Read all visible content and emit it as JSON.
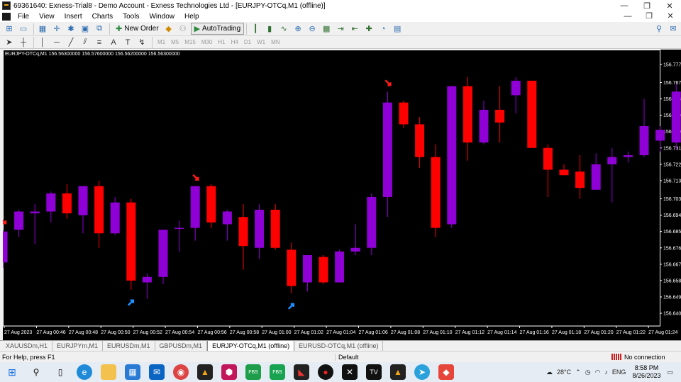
{
  "window": {
    "title": "69361640: Exness-Trial8 - Demo Account - Exness Technologies Ltd - [EURJPY-OTCq,M1 (offline)]",
    "minimize": "—",
    "restore": "❐",
    "close": "✕"
  },
  "menu": {
    "items": [
      "File",
      "View",
      "Insert",
      "Charts",
      "Tools",
      "Window",
      "Help"
    ],
    "right": [
      "—",
      "❐",
      "✕"
    ]
  },
  "toolbar": {
    "new_order": "New Order",
    "autotrading": "AutoTrading"
  },
  "timeframes": [
    "M1",
    "M5",
    "M15",
    "M30",
    "H1",
    "H4",
    "D1",
    "W1",
    "MN"
  ],
  "chart": {
    "header": "EURJPY-OTCq,M1  156.56300000 156.57600000 156.56200000 156.56300000",
    "bg": "#000000",
    "bull_color": "#8e00d6",
    "bear_color": "#ff0000",
    "up_arrow_color": "#1e90ff",
    "down_arrow_color": "#ff1a1a"
  },
  "chart_data": {
    "type": "candlestick",
    "symbol": "EURJPY-OTCq",
    "timeframe": "M1",
    "ylim": [
      156.633,
      156.782
    ],
    "y_ticks": [
      "156.777",
      "156.767",
      "156.758",
      "156.749",
      "156.740",
      "156.731",
      "156.722",
      "156.713",
      "156.703",
      "156.694",
      "156.685",
      "156.676",
      "156.667",
      "156.658",
      "156.649",
      "156.640"
    ],
    "x_ticks": [
      "27 Aug 2023",
      "27 Aug 00:46",
      "27 Aug 00:48",
      "27 Aug 00:50",
      "27 Aug 00:52",
      "27 Aug 00:54",
      "27 Aug 00:56",
      "27 Aug 00:58",
      "27 Aug 01:00",
      "27 Aug 01:02",
      "27 Aug 01:04",
      "27 Aug 01:06",
      "27 Aug 01:08",
      "27 Aug 01:10",
      "27 Aug 01:12",
      "27 Aug 01:14",
      "27 Aug 01:16",
      "27 Aug 01:18",
      "27 Aug 01:20",
      "27 Aug 01:22",
      "27 Aug 01:24"
    ],
    "candles": [
      {
        "o": 156.668,
        "h": 156.686,
        "l": 156.665,
        "c": 156.685
      },
      {
        "o": 156.686,
        "h": 156.697,
        "l": 156.682,
        "c": 156.696
      },
      {
        "o": 156.695,
        "h": 156.7,
        "l": 156.678,
        "c": 156.696
      },
      {
        "o": 156.696,
        "h": 156.707,
        "l": 156.69,
        "c": 156.706
      },
      {
        "o": 156.706,
        "h": 156.711,
        "l": 156.692,
        "c": 156.695
      },
      {
        "o": 156.694,
        "h": 156.707,
        "l": 156.684,
        "c": 156.71
      },
      {
        "o": 156.71,
        "h": 156.713,
        "l": 156.676,
        "c": 156.684
      },
      {
        "o": 156.684,
        "h": 156.704,
        "l": 156.683,
        "c": 156.701
      },
      {
        "o": 156.701,
        "h": 156.703,
        "l": 156.653,
        "c": 156.658
      },
      {
        "o": 156.657,
        "h": 156.662,
        "l": 156.648,
        "c": 156.66
      },
      {
        "o": 156.66,
        "h": 156.686,
        "l": 156.656,
        "c": 156.686
      },
      {
        "o": 156.687,
        "h": 156.691,
        "l": 156.674,
        "c": 156.687
      },
      {
        "o": 156.687,
        "h": 156.71,
        "l": 156.68,
        "c": 156.71
      },
      {
        "o": 156.71,
        "h": 156.711,
        "l": 156.687,
        "c": 156.69
      },
      {
        "o": 156.689,
        "h": 156.697,
        "l": 156.68,
        "c": 156.696
      },
      {
        "o": 156.693,
        "h": 156.7,
        "l": 156.664,
        "c": 156.677
      },
      {
        "o": 156.676,
        "h": 156.7,
        "l": 156.67,
        "c": 156.697
      },
      {
        "o": 156.697,
        "h": 156.7,
        "l": 156.675,
        "c": 156.676
      },
      {
        "o": 156.675,
        "h": 156.679,
        "l": 156.651,
        "c": 156.655
      },
      {
        "o": 156.657,
        "h": 156.672,
        "l": 156.652,
        "c": 156.672
      },
      {
        "o": 156.671,
        "h": 156.672,
        "l": 156.656,
        "c": 156.657
      },
      {
        "o": 156.657,
        "h": 156.675,
        "l": 156.657,
        "c": 156.674
      },
      {
        "o": 156.674,
        "h": 156.689,
        "l": 156.672,
        "c": 156.676
      },
      {
        "o": 156.676,
        "h": 156.706,
        "l": 156.672,
        "c": 156.704
      },
      {
        "o": 156.704,
        "h": 156.762,
        "l": 156.693,
        "c": 156.756
      },
      {
        "o": 156.756,
        "h": 156.757,
        "l": 156.742,
        "c": 156.744
      },
      {
        "o": 156.744,
        "h": 156.748,
        "l": 156.72,
        "c": 156.726
      },
      {
        "o": 156.726,
        "h": 156.733,
        "l": 156.682,
        "c": 156.687
      },
      {
        "o": 156.689,
        "h": 156.765,
        "l": 156.687,
        "c": 156.765
      },
      {
        "o": 156.765,
        "h": 156.77,
        "l": 156.724,
        "c": 156.734
      },
      {
        "o": 156.734,
        "h": 156.757,
        "l": 156.733,
        "c": 156.752
      },
      {
        "o": 156.752,
        "h": 156.765,
        "l": 156.734,
        "c": 156.745
      },
      {
        "o": 156.76,
        "h": 156.77,
        "l": 156.75,
        "c": 156.768
      },
      {
        "o": 156.768,
        "h": 156.768,
        "l": 156.731,
        "c": 156.731
      },
      {
        "o": 156.731,
        "h": 156.733,
        "l": 156.704,
        "c": 156.719
      },
      {
        "o": 156.719,
        "h": 156.722,
        "l": 156.716,
        "c": 156.716
      },
      {
        "o": 156.718,
        "h": 156.727,
        "l": 156.703,
        "c": 156.709
      },
      {
        "o": 156.708,
        "h": 156.728,
        "l": 156.708,
        "c": 156.722
      },
      {
        "o": 156.722,
        "h": 156.731,
        "l": 156.701,
        "c": 156.726
      },
      {
        "o": 156.726,
        "h": 156.729,
        "l": 156.723,
        "c": 156.727
      },
      {
        "o": 156.727,
        "h": 156.758,
        "l": 156.726,
        "c": 156.743
      },
      {
        "o": 156.735,
        "h": 156.743,
        "l": 156.729,
        "c": 156.741
      },
      {
        "o": 156.734,
        "h": 156.766,
        "l": 156.73,
        "c": 156.762
      }
    ],
    "signals": [
      {
        "index": 0,
        "type": "down"
      },
      {
        "index": 8,
        "type": "up"
      },
      {
        "index": 12,
        "type": "down"
      },
      {
        "index": 18,
        "type": "up"
      },
      {
        "index": 24,
        "type": "down"
      }
    ]
  },
  "tabs": [
    "XAUUSDm,H1",
    "EURJPYm,M1",
    "EURUSDm,M1",
    "GBPUSDm,M1",
    "EURJPY-OTCq,M1 (offline)",
    "EURUSD-OTCq,M1 (offline)"
  ],
  "active_tab": "EURJPY-OTCq,M1 (offline)",
  "status": {
    "help": "For Help, press F1",
    "profile": "Default",
    "connection": "No connection"
  },
  "taskbar": {
    "weather": "28°C",
    "lang": "ENG",
    "time": "8:58 PM",
    "date": "8/26/2023"
  }
}
